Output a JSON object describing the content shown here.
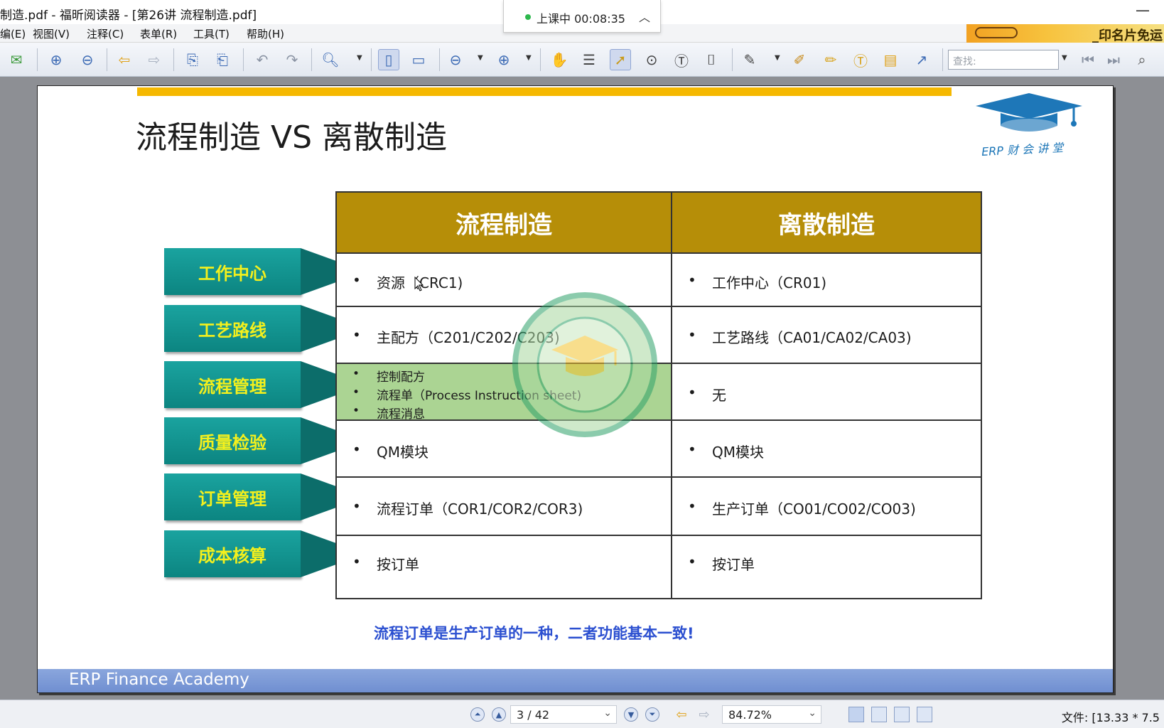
{
  "window": {
    "title": "制造.pdf - 福昕阅读器 - [第26讲  流程制造.pdf]",
    "timer_text": "上课中 00:08:35"
  },
  "menu": [
    "编(E)",
    "视图(V)",
    "注释(C)",
    "表单(R)",
    "工具(T)",
    "帮助(H)"
  ],
  "banner_text": "_印名片免运",
  "toolbar": {
    "search_placeholder": "查找:"
  },
  "slide": {
    "title": "流程制造 VS 离散制造",
    "logo_text": "ERP 财 会 讲 堂",
    "headers": [
      "流程制造",
      "离散制造"
    ],
    "rows": [
      {
        "label": "工作中心",
        "process": [
          "资源（CRC1)"
        ],
        "discrete": [
          "工作中心（CR01)"
        ]
      },
      {
        "label": "工艺路线",
        "process": [
          "主配方（C201/C202/C203)"
        ],
        "discrete": [
          "工艺路线（CA01/CA02/CA03)"
        ]
      },
      {
        "label": "流程管理",
        "process": [
          "控制配方",
          "流程单（Process Instruction sheet)",
          "流程消息"
        ],
        "discrete": [
          "无"
        ]
      },
      {
        "label": "质量检验",
        "process": [
          "QM模块"
        ],
        "discrete": [
          "QM模块"
        ]
      },
      {
        "label": "订单管理",
        "process": [
          "流程订单（COR1/COR2/COR3)"
        ],
        "discrete": [
          "生产订单（CO01/CO02/CO03)"
        ]
      },
      {
        "label": "成本核算",
        "process": [
          "按订单"
        ],
        "discrete": [
          "按订单"
        ]
      }
    ],
    "bullet_symbol": "•",
    "note": "流程订单是生产订单的一种，二者功能基本一致!",
    "footer": "ERP Finance Academy",
    "highlight_color": "#8fc56f",
    "header_color": "#b68e08",
    "label_color": "#0c8581"
  },
  "statusbar": {
    "page": "3 / 42",
    "zoom": "84.72%",
    "file_info": "文件: [13.33 * 7.5"
  }
}
